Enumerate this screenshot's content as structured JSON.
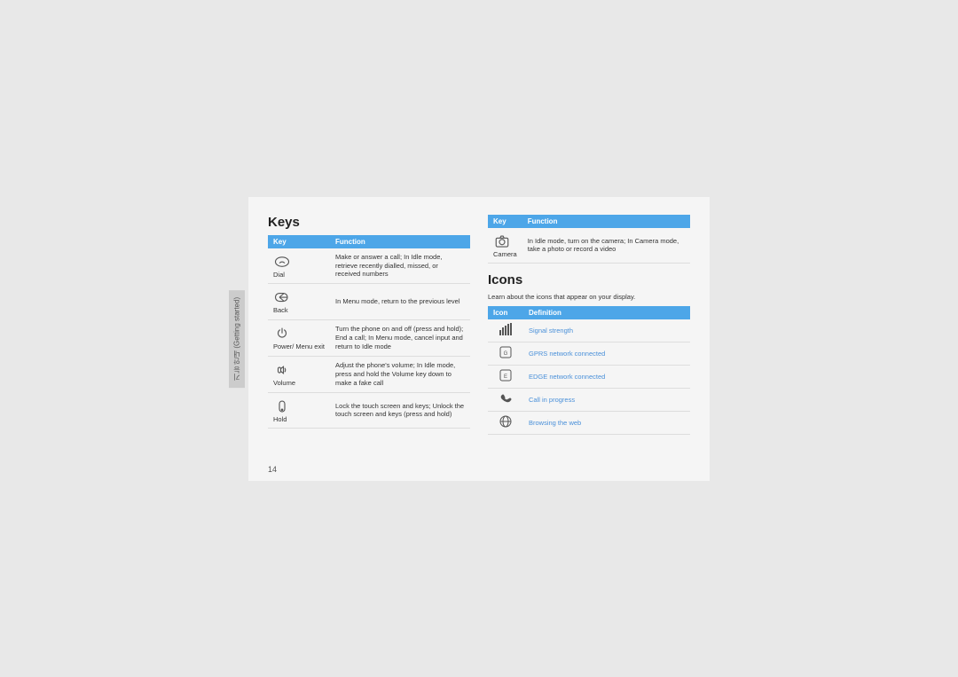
{
  "page": {
    "side_tab": "기능 안내 (Getting started)",
    "page_number": "14",
    "keys_section": {
      "title": "Keys",
      "table": {
        "col_key": "Key",
        "col_function": "Function",
        "rows": [
          {
            "key_name": "Dial",
            "icon": "dial",
            "function": "Make or answer a call; In Idle mode, retrieve recently dialled, missed, or received numbers"
          },
          {
            "key_name": "Back",
            "icon": "back",
            "function": "In Menu mode, return to the previous level"
          },
          {
            "key_name": "Power/ Menu exit",
            "icon": "power",
            "function": "Turn the phone on and off (press and hold); End a call; In Menu mode, cancel input and return to Idle mode"
          },
          {
            "key_name": "Volume",
            "icon": "volume",
            "function": "Adjust the phone's volume; In Idle mode, press and hold the Volume key down to make a fake call"
          },
          {
            "key_name": "Hold",
            "icon": "hold",
            "function": "Lock the touch screen and keys; Unlock the touch screen and keys (press and hold)"
          }
        ]
      }
    },
    "right_section": {
      "camera_table": {
        "col_key": "Key",
        "col_function": "Function",
        "rows": [
          {
            "key_name": "Camera",
            "icon": "camera",
            "function": "In Idle mode, turn on the camera; In Camera mode, take a photo or record a video"
          }
        ]
      },
      "icons_section": {
        "title": "Icons",
        "description": "Learn about the icons that appear on your display.",
        "table": {
          "col_icon": "Icon",
          "col_definition": "Definition",
          "rows": [
            {
              "icon": "signal",
              "definition": "Signal strength"
            },
            {
              "icon": "gprs",
              "definition": "GPRS network connected"
            },
            {
              "icon": "edge",
              "definition": "EDGE network connected"
            },
            {
              "icon": "call",
              "definition": "Call in progress"
            },
            {
              "icon": "web",
              "definition": "Browsing the web"
            }
          ]
        }
      }
    }
  }
}
